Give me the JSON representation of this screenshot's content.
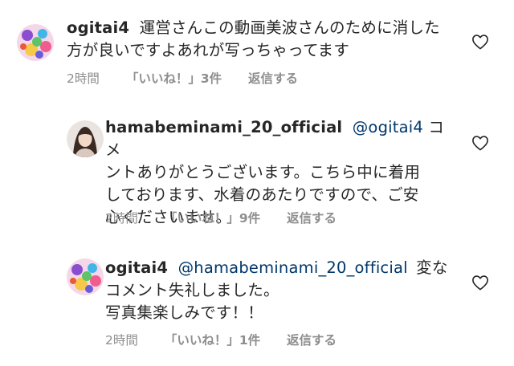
{
  "comments": [
    {
      "username": "ogitai4",
      "mention": "",
      "text_lines": [
        "運営さんこの動画美波さんのために消した",
        "方が良いですよあれが写っちゃってます"
      ],
      "time": "2時間",
      "likes": "「いいね！」3件",
      "reply": "返信する",
      "avatar_icon": "cartoon-avatar-icon"
    },
    {
      "username": "hamabeminami_20_official",
      "mention": "@ogitai4",
      "text_lines": [
        "コメ",
        "ントありがとうございます。こちら中に着用",
        "しております、水着のあたりですので、ご安",
        "心くださいませ。"
      ],
      "time": "2時間",
      "likes": "「いいね！」9件",
      "reply": "返信する",
      "avatar_icon": "profile-photo-icon"
    },
    {
      "username": "ogitai4",
      "mention": "@hamabeminami_20_official",
      "text_lines": [
        "変な",
        "コメント失礼しました。",
        "写真集楽しみです！！"
      ],
      "time": "2時間",
      "likes": "「いいね！」1件",
      "reply": "返信する",
      "avatar_icon": "cartoon-avatar-icon"
    }
  ],
  "colors": {
    "text": "#262626",
    "mention": "#00376b",
    "meta": "#8e8e8e"
  }
}
